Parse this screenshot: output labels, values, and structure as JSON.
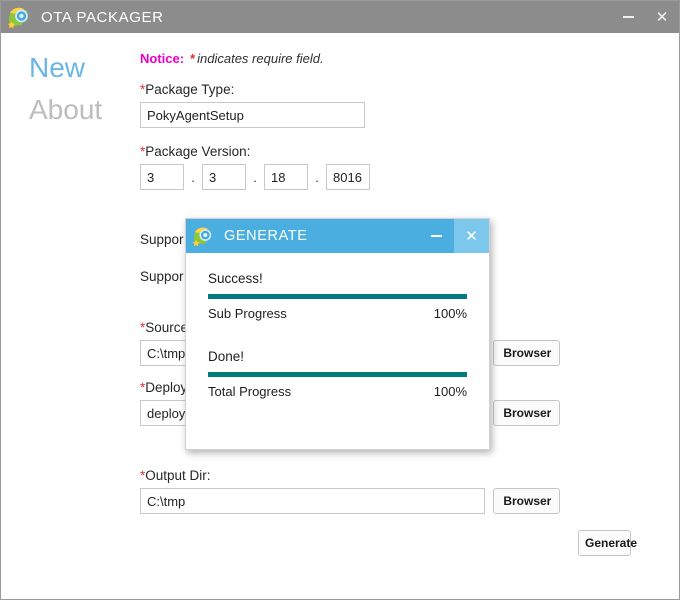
{
  "window": {
    "title": "OTA PACKAGER",
    "icon": "ota-app-icon",
    "minimize_label": "–",
    "close_label": "✕"
  },
  "sidebar": {
    "items": [
      {
        "label": "New",
        "active": true
      },
      {
        "label": "About",
        "active": false
      }
    ]
  },
  "form": {
    "notice": {
      "label": "Notice:",
      "star": "*",
      "text": "indicates require field."
    },
    "package_type": {
      "required": "*",
      "label": "Package Type:",
      "value": "PokyAgentSetup"
    },
    "package_version": {
      "required": "*",
      "label": "Package Version:",
      "separator": ".",
      "parts": [
        "3",
        "3",
        "18",
        "8016"
      ]
    },
    "support_label_1": "Suppor",
    "support_label_2": "Suppor",
    "source": {
      "required": "*",
      "label": "Source",
      "value": "C:\\tmp'",
      "browser_label": "Browser"
    },
    "deploy": {
      "required": "*",
      "label": "Deploy",
      "value": "deploy",
      "browser_label": "Browser"
    },
    "output_dir": {
      "required": "*",
      "label": "Output Dir:",
      "value": "C:\\tmp",
      "browser_label": "Browser"
    },
    "generate_label": "Generate"
  },
  "dialog": {
    "title": "GENERATE",
    "icon": "ota-app-icon",
    "minimize_label": "–",
    "close_label": "✕",
    "sub": {
      "status": "Success!",
      "legend": "Sub Progress",
      "percent": "100%",
      "value": 100
    },
    "total": {
      "status": "Done!",
      "legend": "Total Progress",
      "percent": "100%",
      "value": 100
    }
  },
  "colors": {
    "titlebar": "#8c8c8c",
    "dialog_titlebar": "#4aaee0",
    "progress": "#007b80",
    "accent_blue": "#6cb6e6",
    "notice": "#ea00c8",
    "required": "#e03030"
  }
}
